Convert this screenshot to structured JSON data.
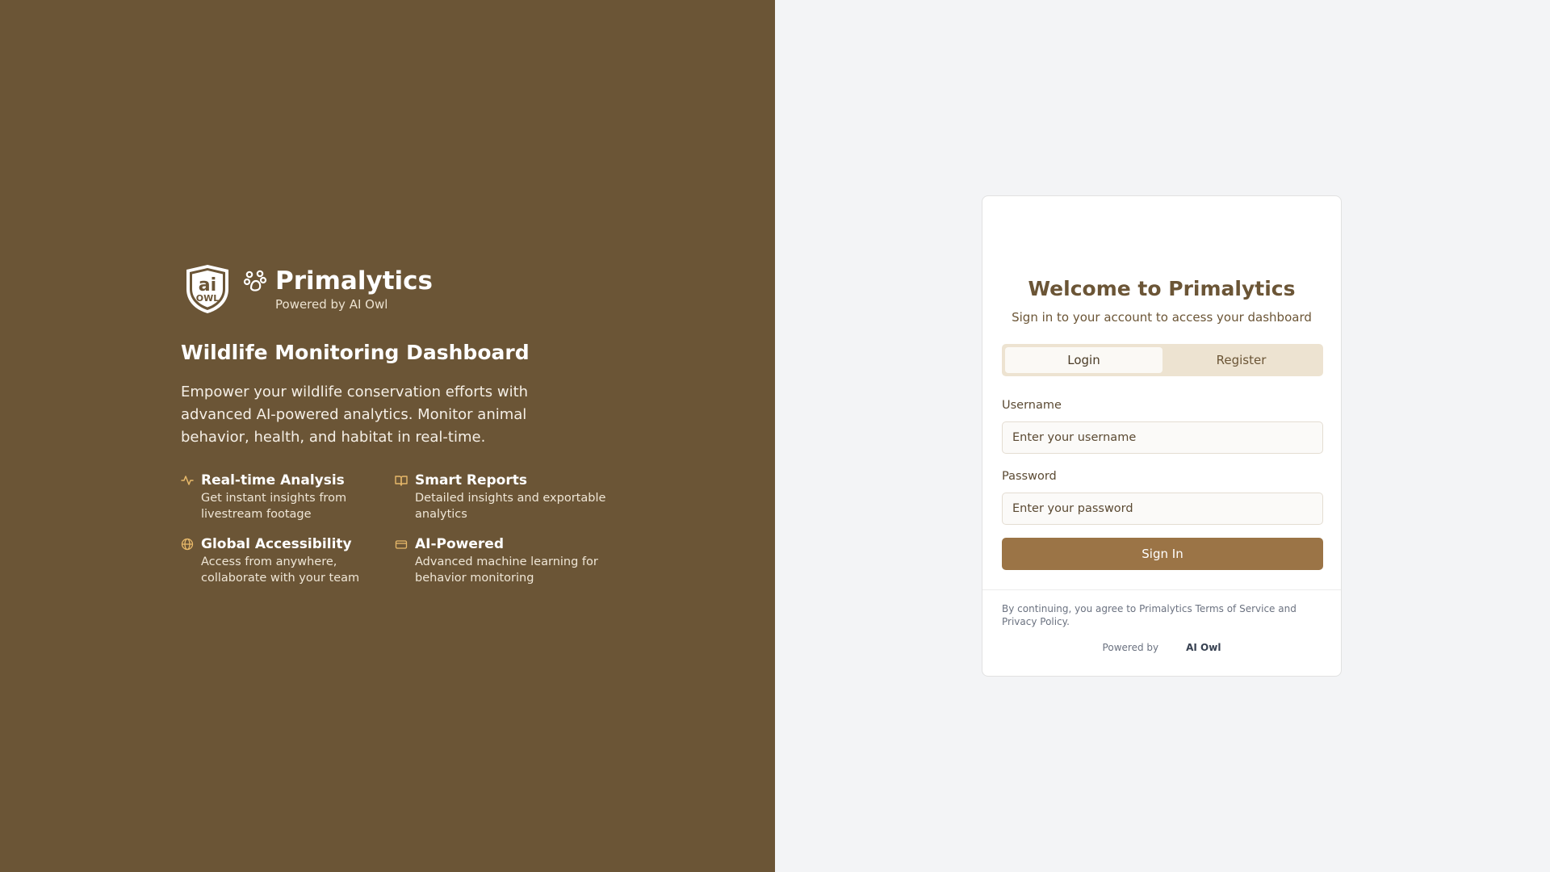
{
  "brand": {
    "logo_text_top": "ai",
    "logo_text_bottom": "OWL",
    "name": "Primalytics",
    "subtitle": "Powered by AI Owl",
    "paw_icon": "paw-icon",
    "shield_icon": "ai-owl-shield-logo"
  },
  "hero": {
    "headline": "Wildlife Monitoring Dashboard",
    "description": "Empower your wildlife conservation efforts with advanced AI-powered analytics. Monitor animal behavior, health, and habitat in real-time."
  },
  "features": [
    {
      "icon": "activity-icon",
      "title": "Real-time Analysis",
      "desc": "Get instant insights from livestream footage"
    },
    {
      "icon": "book-open-icon",
      "title": "Smart Reports",
      "desc": "Detailed insights and exportable analytics"
    },
    {
      "icon": "globe-icon",
      "title": "Global Accessibility",
      "desc": "Access from anywhere, collaborate with your team"
    },
    {
      "icon": "card-icon",
      "title": "AI-Powered",
      "desc": "Advanced machine learning for behavior monitoring"
    }
  ],
  "login": {
    "title": "Welcome to Primalytics",
    "subtitle": "Sign in to your account to access your dashboard",
    "tabs": [
      {
        "label": "Login",
        "active": true
      },
      {
        "label": "Register",
        "active": false
      }
    ],
    "username_label": "Username",
    "username_placeholder": "Enter your username",
    "username_value": "",
    "password_label": "Password",
    "password_placeholder": "Enter your password",
    "password_value": "",
    "submit_label": "Sign In",
    "terms": "By continuing, you agree to Primalytics Terms of Service and Privacy Policy.",
    "powered_by": "Powered by",
    "powered_brand": "AI Owl"
  },
  "colors": {
    "left_bg": "#6b5536",
    "right_bg": "#f3f4f6",
    "accent": "#9b7446",
    "feature_icon": "#e8b96a",
    "title_brown": "#6b5536"
  }
}
